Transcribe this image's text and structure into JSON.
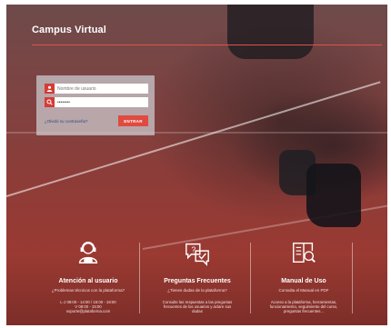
{
  "header": {
    "brand": "Campus Virtual"
  },
  "login": {
    "username_placeholder": "Nombre de usuario",
    "password_mask": "••••••••",
    "forgot_link": "¿Olvidó su contraseña?",
    "submit_label": "ENTRAR",
    "icons": [
      "user-icon",
      "search-icon"
    ]
  },
  "features": [
    {
      "icon": "support-agent-icon",
      "title": "Atención al usuario",
      "subtitle": "¿Problemas técnicos con la plataforma?",
      "lines": [
        "L-J 09:00 - 14:00 / 16:00 - 19:00",
        "V 08:00 - 15:00",
        "soporte@plataforma.com"
      ]
    },
    {
      "icon": "faq-bubbles-icon",
      "title": "Preguntas Frecuentes",
      "subtitle": "¿Tienes dudas de la plataforma?",
      "lines": [
        "Consulte las respuestas a las preguntas",
        "frecuentes de los usuarios y aclare sus",
        "dudas"
      ]
    },
    {
      "icon": "manual-search-icon",
      "title": "Manual de Uso",
      "subtitle": "Consulta el Manual en PDF",
      "lines": [
        "Acceso a la plataforma, herramientas,",
        "funcionamiento, seguimiento del curso,",
        "preguntas frecuentes..."
      ]
    }
  ],
  "colors": {
    "accent": "#e04a3f",
    "panel": "#cdcdd2"
  }
}
